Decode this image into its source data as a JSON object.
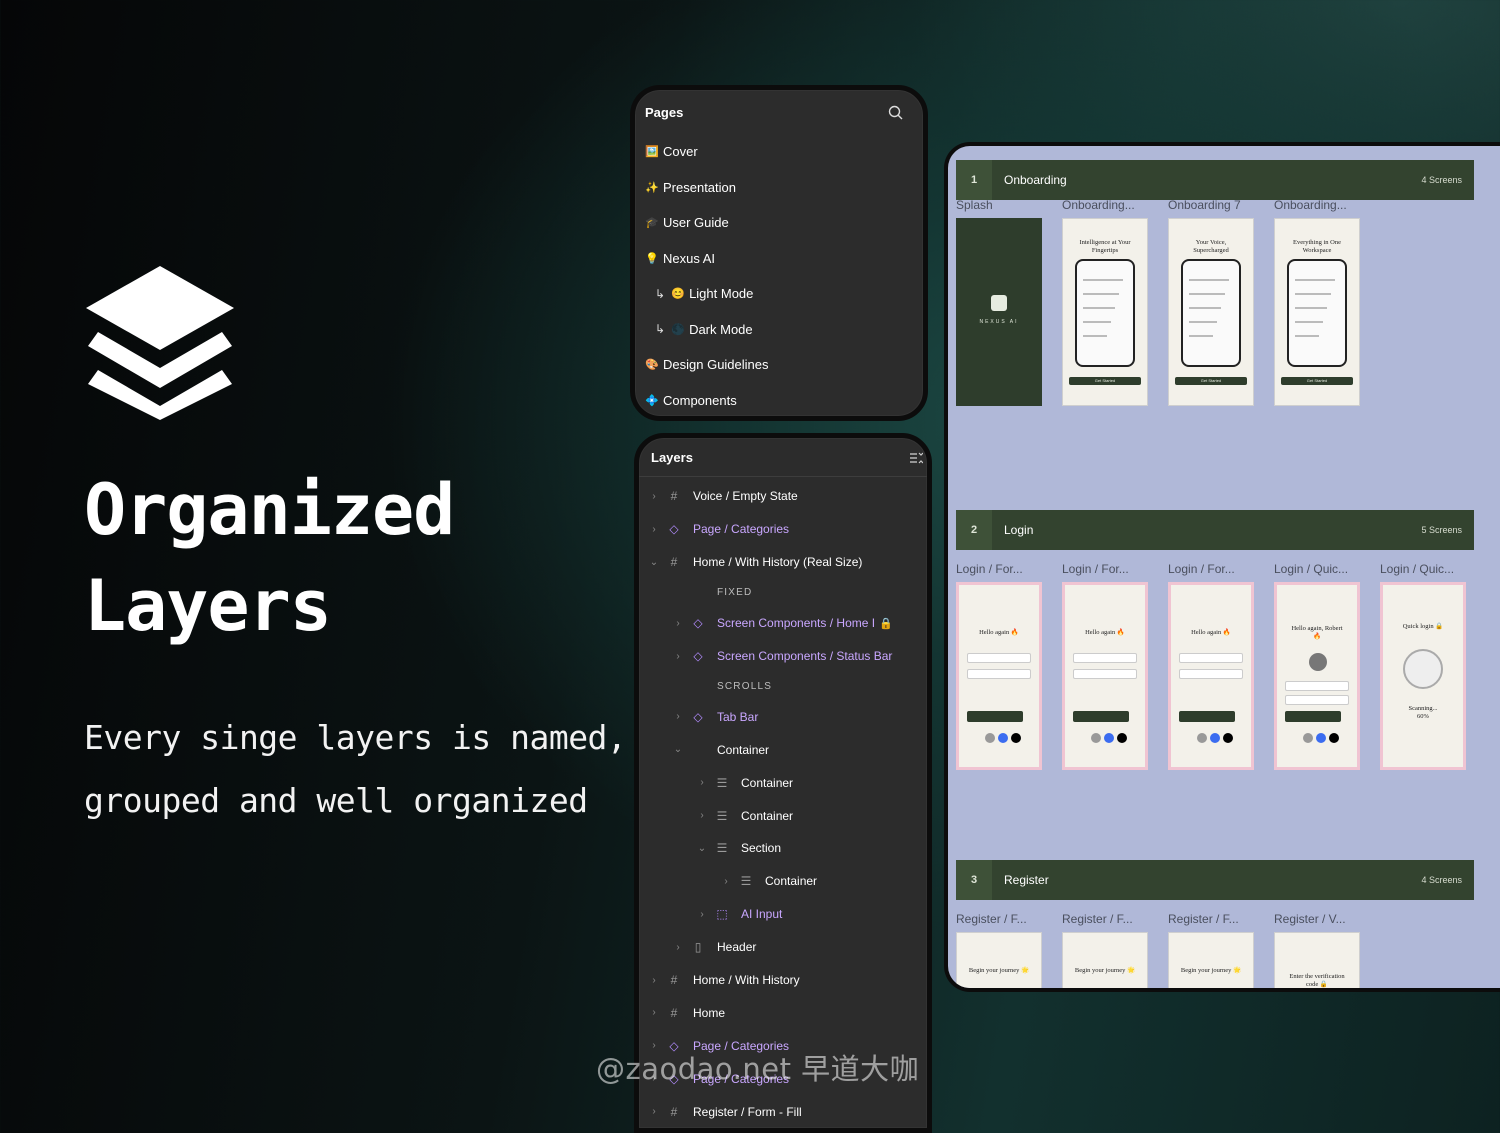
{
  "hero": {
    "title_line1": "Organized",
    "title_line2": "Layers",
    "subtitle_line1": "Every singe layers is named,",
    "subtitle_line2": "grouped and well organized"
  },
  "pages_panel": {
    "title": "Pages",
    "items": [
      {
        "icon": "🖼️",
        "label": "Cover"
      },
      {
        "icon": "✨",
        "label": "Presentation"
      },
      {
        "icon": "🎓",
        "label": "User Guide"
      },
      {
        "icon": "💡",
        "label": "Nexus AI"
      },
      {
        "icon": "😊",
        "label": "Light Mode",
        "sub": true
      },
      {
        "icon": "🌑",
        "label": "Dark Mode",
        "sub": true
      },
      {
        "icon": "🎨",
        "label": "Design Guidelines"
      },
      {
        "icon": "💠",
        "label": "Components"
      }
    ]
  },
  "layers_panel": {
    "title": "Layers",
    "rows": [
      {
        "label": "Voice / Empty State",
        "icon": "frame-icon",
        "depth": 0,
        "chev": "›"
      },
      {
        "label": "Page / Categories",
        "icon": "component-icon",
        "depth": 0,
        "chev": "›",
        "component": true
      },
      {
        "label": "Home / With History (Real Size)",
        "icon": "frame-icon",
        "depth": 0,
        "chev": "⌄"
      },
      {
        "label": "FIXED",
        "section": true,
        "depth": 1
      },
      {
        "label": "Screen Components / Home I",
        "icon": "component-icon",
        "depth": 1,
        "chev": "›",
        "component": true,
        "locked": true
      },
      {
        "label": "Screen Components / Status Bar",
        "icon": "component-icon",
        "depth": 1,
        "chev": "›",
        "component": true
      },
      {
        "label": "SCROLLS",
        "section": true,
        "depth": 1
      },
      {
        "label": "Tab Bar",
        "icon": "component-icon",
        "depth": 1,
        "chev": "›",
        "component": true
      },
      {
        "label": "Container",
        "icon": "",
        "depth": 1,
        "chev": "⌄"
      },
      {
        "label": "Container",
        "icon": "stack-icon",
        "depth": 2,
        "chev": "›"
      },
      {
        "label": "Container",
        "icon": "stack-icon",
        "depth": 2,
        "chev": "›"
      },
      {
        "label": "Section",
        "icon": "stack-icon",
        "depth": 2,
        "chev": "⌄"
      },
      {
        "label": "Container",
        "icon": "stack-icon",
        "depth": 3,
        "chev": "›"
      },
      {
        "label": "AI Input",
        "icon": "instance-icon",
        "depth": 2,
        "chev": "›",
        "component": true
      },
      {
        "label": "Header",
        "icon": "auto-layout-icon",
        "depth": 1,
        "chev": "›"
      },
      {
        "label": "Home / With History",
        "icon": "frame-icon",
        "depth": 0,
        "chev": "›"
      },
      {
        "label": "Home",
        "icon": "frame-icon",
        "depth": 0,
        "chev": "›"
      },
      {
        "label": "Page / Categories",
        "icon": "component-icon",
        "depth": 0,
        "chev": "›",
        "component": true
      },
      {
        "label": "Page / Categories",
        "icon": "component-icon",
        "depth": 0,
        "chev": "›",
        "component": true
      },
      {
        "label": "Register / Form - Fill",
        "icon": "frame-icon",
        "depth": 0,
        "chev": "›"
      }
    ]
  },
  "canvas": {
    "sections": [
      {
        "num": "1",
        "name": "Onboarding",
        "count": "4 Screens",
        "frames": [
          {
            "label": "Splash",
            "kind": "splash",
            "brand": "NEXUS AI"
          },
          {
            "label": "Onboarding...",
            "kind": "onboard",
            "headline": "Intelligence at Your Fingertips",
            "cta": "Get Started"
          },
          {
            "label": "Onboarding 7",
            "kind": "onboard",
            "headline": "Your Voice, Supercharged",
            "cta": "Get Started"
          },
          {
            "label": "Onboarding...",
            "kind": "onboard",
            "headline": "Everything in One Workspace",
            "cta": "Get Started"
          }
        ]
      },
      {
        "num": "2",
        "name": "Login",
        "count": "5 Screens",
        "frames": [
          {
            "label": "Login / For...",
            "kind": "login",
            "headline": "Hello again 🔥"
          },
          {
            "label": "Login / For...",
            "kind": "login",
            "headline": "Hello again 🔥"
          },
          {
            "label": "Login / For...",
            "kind": "login",
            "headline": "Hello again 🔥"
          },
          {
            "label": "Login / Quic...",
            "kind": "login-avatar",
            "headline": "Hello again, Robert 🔥"
          },
          {
            "label": "Login / Quic...",
            "kind": "quick",
            "headline": "Quick login 🔒",
            "progress": "Scanning... 60%"
          }
        ]
      },
      {
        "num": "3",
        "name": "Register",
        "count": "4 Screens",
        "frames": [
          {
            "label": "Register / F...",
            "kind": "register",
            "headline": "Begin your journey 🌟"
          },
          {
            "label": "Register / F...",
            "kind": "register",
            "headline": "Begin your journey 🌟"
          },
          {
            "label": "Register / F...",
            "kind": "register",
            "headline": "Begin your journey 🌟"
          },
          {
            "label": "Register / V...",
            "kind": "register",
            "headline": "Enter the verification code 🔒"
          }
        ]
      }
    ]
  },
  "watermark": "@zaodao.net 早道大咖",
  "colors": {
    "panel_bg": "#2c2c2c",
    "component_purple": "#c9a7ff",
    "canvas_bg": "#b0b8d8",
    "section_green": "#33432f",
    "brand_green": "#2e3d2c",
    "login_pink": "#f0c4d2"
  }
}
